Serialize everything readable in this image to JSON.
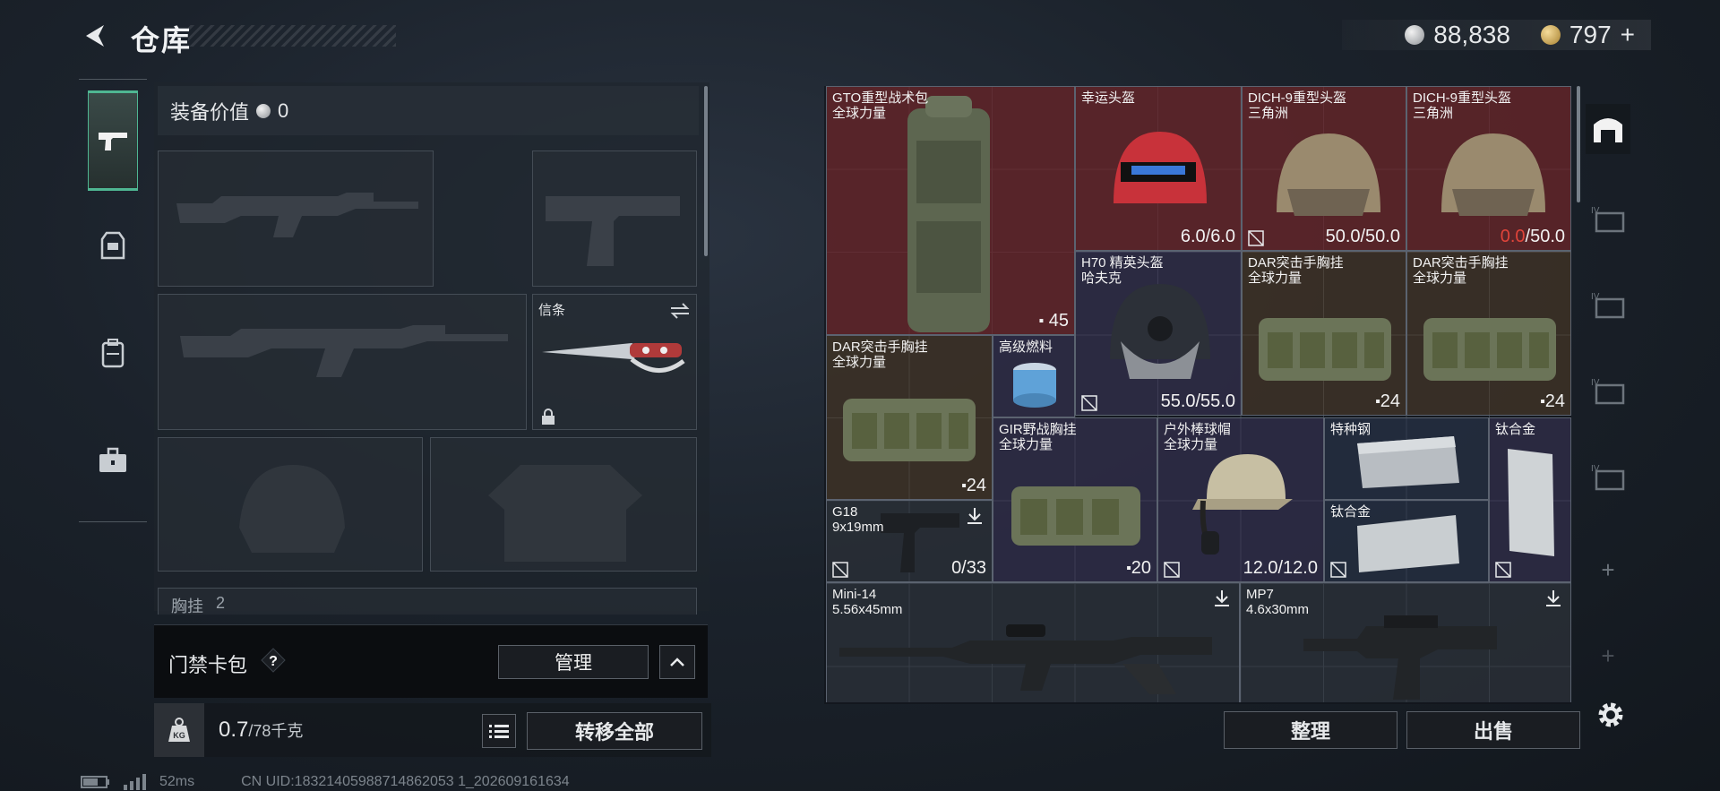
{
  "header": {
    "title": "仓库",
    "currency_silver": "88,838",
    "currency_gold": "797",
    "currency_add": "+"
  },
  "left_nav": {
    "items": [
      "weapon-tab",
      "equipment-tab",
      "backpack-tab",
      "toolbox-tab"
    ],
    "active": "weapon-tab"
  },
  "equipment": {
    "value_label": "装备价值",
    "value": "0",
    "melee_label": "信条",
    "chest_label": "胸挂",
    "chest_count": "2"
  },
  "keycard": {
    "label": "门禁卡包",
    "help": "?",
    "manage_label": "管理"
  },
  "weight": {
    "current": "0.7",
    "max": "/78千克",
    "kg_badge": "KG",
    "transfer_label": "转移全部"
  },
  "status": {
    "ping": "52ms",
    "uid": "CN UID:18321405988714862053 1_202609161634"
  },
  "stash": {
    "items": [
      {
        "name": "GTO重型战术包",
        "sub": "全球力量",
        "stat": "45",
        "color": "red"
      },
      {
        "name": "幸运头盔",
        "sub": "",
        "stat": "6.0/6.0",
        "color": "red"
      },
      {
        "name": "DICH-9重型头盔",
        "sub": "三角洲",
        "stat": "50.0/50.0",
        "color": "red"
      },
      {
        "name": "DICH-9重型头盔",
        "sub": "三角洲",
        "stat_warn": "0.0",
        "stat_rest": "/50.0",
        "color": "red"
      },
      {
        "name": "H70 精英头盔",
        "sub": "哈夫克",
        "stat": "55.0/55.0",
        "color": "purple"
      },
      {
        "name": "DAR突击手胸挂",
        "sub": "全球力量",
        "stat": "24",
        "color": "brown"
      },
      {
        "name": "DAR突击手胸挂",
        "sub": "全球力量",
        "stat": "24",
        "color": "brown"
      },
      {
        "name": "DAR突击手胸挂",
        "sub": "全球力量",
        "stat": "24",
        "color": "brown"
      },
      {
        "name": "高级燃料",
        "sub": "",
        "stat": "",
        "color": "purple"
      },
      {
        "name": "GIR野战胸挂",
        "sub": "全球力量",
        "stat": "20",
        "color": "purple"
      },
      {
        "name": "户外棒球帽",
        "sub": "全球力量",
        "stat": "12.0/12.0",
        "color": "purple"
      },
      {
        "name": "特种钢",
        "sub": "",
        "stat": "",
        "color": "blue"
      },
      {
        "name": "钛合金",
        "sub": "",
        "stat": "",
        "color": "purple"
      },
      {
        "name": "钛合金",
        "sub": "",
        "stat": "",
        "color": "blue"
      },
      {
        "name": "G18",
        "sub": "9x19mm",
        "stat": "0/33",
        "color": "grey"
      },
      {
        "name": "Mini-14",
        "sub": "5.56x45mm",
        "stat": "",
        "color": "grey"
      },
      {
        "name": "MP7",
        "sub": "4.6x30mm",
        "stat": "",
        "color": "grey"
      }
    ]
  },
  "right_strip": {
    "add1": "+",
    "add2": "+"
  },
  "actions": {
    "sort_label": "整理",
    "sell_label": "出售"
  },
  "colors": {
    "accent": "#4fb692",
    "rare_red": "#6e282c",
    "rare_purple": "#3e385c",
    "rare_brown": "#564228",
    "warn": "#e0443a"
  }
}
